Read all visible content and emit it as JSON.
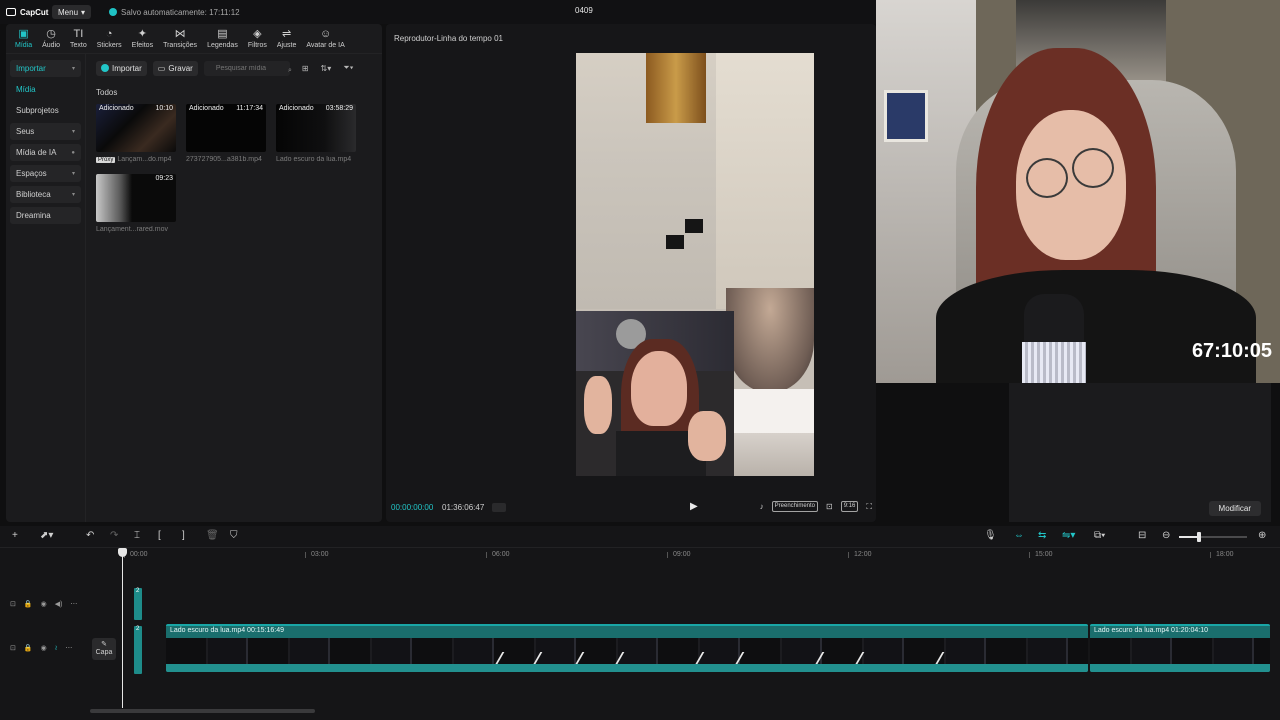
{
  "app": {
    "logo_text": "CapCut",
    "menu_label": "Menu",
    "autosave_text": "Salvo automaticamente: 17:11:12",
    "project_title": "0409"
  },
  "tool_tabs": [
    {
      "label": "Mídia",
      "icon": "media-icon",
      "glyph": "▣",
      "active": true
    },
    {
      "label": "Áudio",
      "icon": "audio-icon",
      "glyph": "◷",
      "active": false
    },
    {
      "label": "Texto",
      "icon": "text-icon",
      "glyph": "TI",
      "active": false
    },
    {
      "label": "Stickers",
      "icon": "sticker-icon",
      "glyph": "◔",
      "active": false
    },
    {
      "label": "Efeitos",
      "icon": "effects-icon",
      "glyph": "✦",
      "active": false
    },
    {
      "label": "Transições",
      "icon": "transitions-icon",
      "glyph": "⋈",
      "active": false
    },
    {
      "label": "Legendas",
      "icon": "captions-icon",
      "glyph": "▤",
      "active": false
    },
    {
      "label": "Filtros",
      "icon": "filters-icon",
      "glyph": "◈",
      "active": false
    },
    {
      "label": "Ajuste",
      "icon": "adjust-icon",
      "glyph": "⇌",
      "active": false
    },
    {
      "label": "Avatar de IA",
      "icon": "ai-avatar-icon",
      "glyph": "☺",
      "active": false
    }
  ],
  "side_nav": [
    {
      "label": "Importar",
      "chevron": "▾",
      "highlight": true,
      "active": true
    },
    {
      "label": "Mídia",
      "chevron": "",
      "highlight": false,
      "active": true
    },
    {
      "label": "Subprojetos",
      "chevron": "",
      "highlight": false,
      "active": false
    },
    {
      "label": "Seus",
      "chevron": "▾",
      "highlight": true,
      "active": false
    },
    {
      "label": "Mídia de IA",
      "chevron": "●",
      "highlight": true,
      "active": false
    },
    {
      "label": "Espaços",
      "chevron": "▾",
      "highlight": true,
      "active": false
    },
    {
      "label": "Biblioteca",
      "chevron": "▾",
      "highlight": true,
      "active": false
    },
    {
      "label": "Dreamina",
      "chevron": "",
      "highlight": true,
      "active": false
    }
  ],
  "media_toolbar": {
    "import_label": "Importar",
    "record_label": "Gravar",
    "search_placeholder": "Pesquisar mídia"
  },
  "media": {
    "section_label": "Todos",
    "items": [
      {
        "tag": "Adicionado",
        "duration": "10:10",
        "name": "Lançam...do.mp4",
        "proxy": "Proxy"
      },
      {
        "tag": "Adicionado",
        "duration": "11:17:34",
        "name": "273727905...a381b.mp4",
        "proxy": ""
      },
      {
        "tag": "Adicionado",
        "duration": "03:58:29",
        "name": "Lado escuro da lua.mp4",
        "proxy": ""
      },
      {
        "tag": "",
        "duration": "09:23",
        "name": "Lançament...rared.mov",
        "proxy": ""
      }
    ]
  },
  "player": {
    "title": "Reprodutor-Linha do tempo 01",
    "current_time": "00:00:00:00",
    "total_time": "01:36:06:47",
    "fill_label": "Preenchimento",
    "ratio_label": "9:16"
  },
  "webcam": {
    "timer": "67:10:05"
  },
  "right_panel": {
    "modify_label": "Modificar"
  },
  "timeline": {
    "ruler_labels": [
      "00:00",
      "03:00",
      "06:00",
      "09:00",
      "12:00",
      "15:00",
      "18:00"
    ],
    "cover_label": "Capa",
    "track_number": "2",
    "clips": [
      {
        "label": "Lado escuro da lua.mp4   00:15:16:49"
      },
      {
        "label": "Lado escuro da lua.mp4   01:20:04:10"
      }
    ]
  },
  "colors": {
    "accent": "#22c6c8",
    "clip": "#1a6e6d",
    "background": "#0f0f10"
  }
}
